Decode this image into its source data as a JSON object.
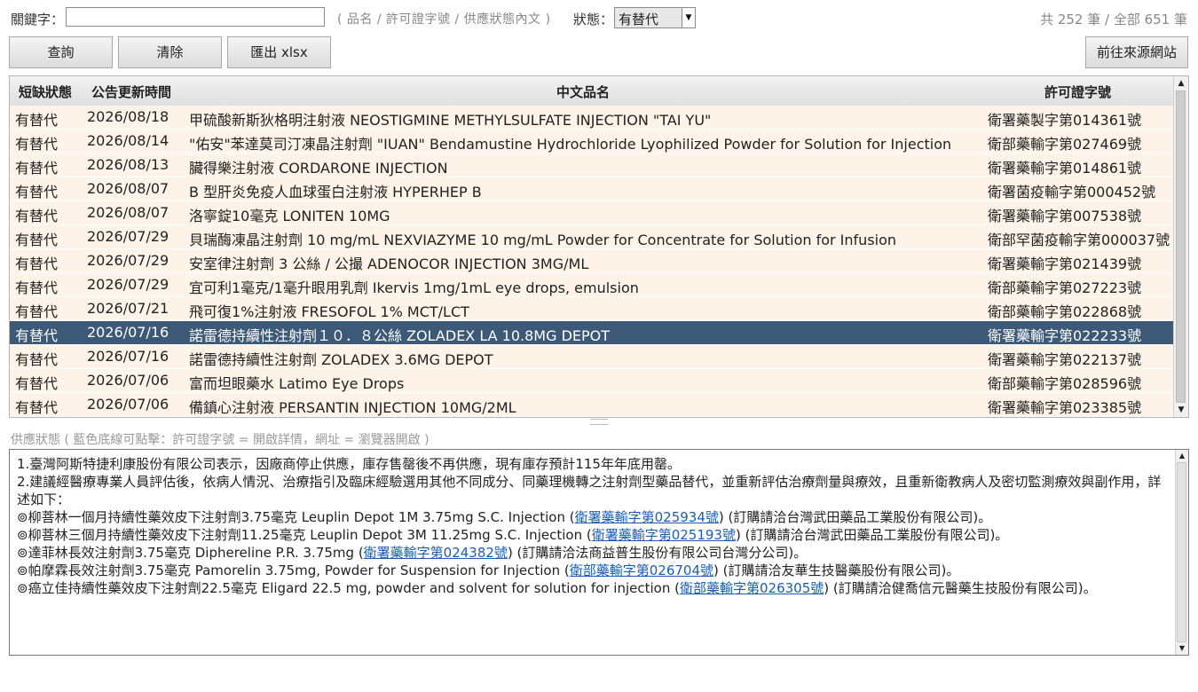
{
  "search": {
    "keyword_label": "關鍵字：",
    "keyword_value": "",
    "hint": "( 品名 / 許可證字號 / 供應狀態內文 )",
    "status_label": "狀態：",
    "status_selected": "有替代",
    "count_text": "共 252 筆 / 全部 651 筆"
  },
  "toolbar": {
    "query": "查詢",
    "clear": "清除",
    "export": "匯出 xlsx",
    "goto_source": "前往來源網站"
  },
  "table": {
    "columns": [
      "短缺狀態",
      "公告更新時間",
      "中文品名",
      "許可證字號"
    ],
    "selected_index": 9,
    "rows": [
      [
        "有替代",
        "2026/08/18",
        "甲硫酸新斯狄格明注射液 NEOSTIGMINE METHYLSULFATE INJECTION \"TAI YU\"",
        "衛署藥製字第014361號"
      ],
      [
        "有替代",
        "2026/08/14",
        "\"佑安\"苯達莫司汀凍晶注射劑 \"IUAN\" Bendamustine Hydrochloride Lyophilized Powder for Solution for Injection",
        "衛部藥輸字第027469號"
      ],
      [
        "有替代",
        "2026/08/13",
        "臟得樂注射液 CORDARONE INJECTION",
        "衛署藥輸字第014861號"
      ],
      [
        "有替代",
        "2026/08/07",
        " B 型肝炎免疫人血球蛋白注射液 HYPERHEP B",
        "衛署菌疫輸字第000452號"
      ],
      [
        "有替代",
        "2026/08/07",
        "洛寧錠10毫克 LONITEN 10MG",
        "衛署藥輸字第007538號"
      ],
      [
        "有替代",
        "2026/07/29",
        "貝瑞酶凍晶注射劑 10 mg/mL NEXVIAZYME 10 mg/mL Powder for Concentrate for Solution for Infusion",
        "衛部罕菌疫輸字第000037號"
      ],
      [
        "有替代",
        "2026/07/29",
        "安室律注射劑 3 公絲 / 公撮 ADENOCOR INJECTION 3MG/ML",
        "衛署藥輸字第021439號"
      ],
      [
        "有替代",
        "2026/07/29",
        "宜可利1毫克/1毫升眼用乳劑 Ikervis 1mg/1mL eye drops, emulsion",
        "衛部藥輸字第027223號"
      ],
      [
        "有替代",
        "2026/07/21",
        "飛可復1%注射液 FRESOFOL 1% MCT/LCT",
        "衛部藥輸字第022868號"
      ],
      [
        "有替代",
        "2026/07/16",
        "諾雷德持續性注射劑１０．８公絲 ZOLADEX LA 10.8MG DEPOT",
        "衛署藥輸字第022233號"
      ],
      [
        "有替代",
        "2026/07/16",
        "諾雷德持續性注射劑 ZOLADEX 3.6MG DEPOT",
        "衛署藥輸字第022137號"
      ],
      [
        "有替代",
        "2026/07/06",
        "富而坦眼藥水 Latimo Eye Drops",
        "衛部藥輸字第028596號"
      ],
      [
        "有替代",
        "2026/07/06",
        "備鎮心注射液 PERSANTIN INJECTION 10MG/2ML",
        "衛署藥輸字第023385號"
      ]
    ]
  },
  "detail": {
    "label": "供應狀態 ( 藍色底線可點擊：許可證字號 = 開啟詳情，網址 = 瀏覽器開啟 )",
    "line1": "1.臺灣阿斯特捷利康股份有限公司表示，因廠商停止供應，庫存售罄後不再供應，現有庫存預計115年年底用罄。",
    "line2": "2.建議經醫療專業人員評估後，依病人情況、治療指引及臨床經驗選用其他不同成分、同藥理機轉之注射劑型藥品替代，並重新評估治療劑量與療效，且重新衛教病人及密切監測療效與副作用，詳述如下：",
    "items": [
      {
        "pre": "⊚柳菩林一個月持續性藥效皮下注射劑3.75毫克 Leuplin Depot 1M 3.75mg S.C. Injection (",
        "link": "衛署藥輸字第025934號",
        "post": ") (訂購請洽台灣武田藥品工業股份有限公司)。"
      },
      {
        "pre": "⊚柳菩林三個月持續性藥效皮下注射劑11.25毫克 Leuplin Depot 3M 11.25mg S.C. Injection (",
        "link": "衛署藥輸字第025193號",
        "post": ") (訂購請洽台灣武田藥品工業股份有限公司)。"
      },
      {
        "pre": "⊚達菲林長效注射劑3.75毫克 Diphereline P.R. 3.75mg (",
        "link": "衛署藥輸字第024382號",
        "post": ") (訂購請洽法商益普生股份有限公司台灣分公司)。"
      },
      {
        "pre": "⊚帕摩霖長效注射劑3.75毫克 Pamorelin 3.75mg, Powder for Suspension for Injection (",
        "link": "衛部藥輸字第026704號",
        "post": ") (訂購請洽友華生技醫藥股份有限公司)。"
      },
      {
        "pre": "⊚癌立佳持續性藥效皮下注射劑22.5毫克 Eligard 22.5 mg, powder and solvent for solution for injection (",
        "link": "衛部藥輸字第026305號",
        "post": ") (訂購請洽健喬信元醫藥生技股份有限公司)。"
      }
    ]
  },
  "colors": {
    "row_bg": "#fdf3e8",
    "selected_row_bg": "#3c5a78",
    "link": "#1a5fb4"
  }
}
